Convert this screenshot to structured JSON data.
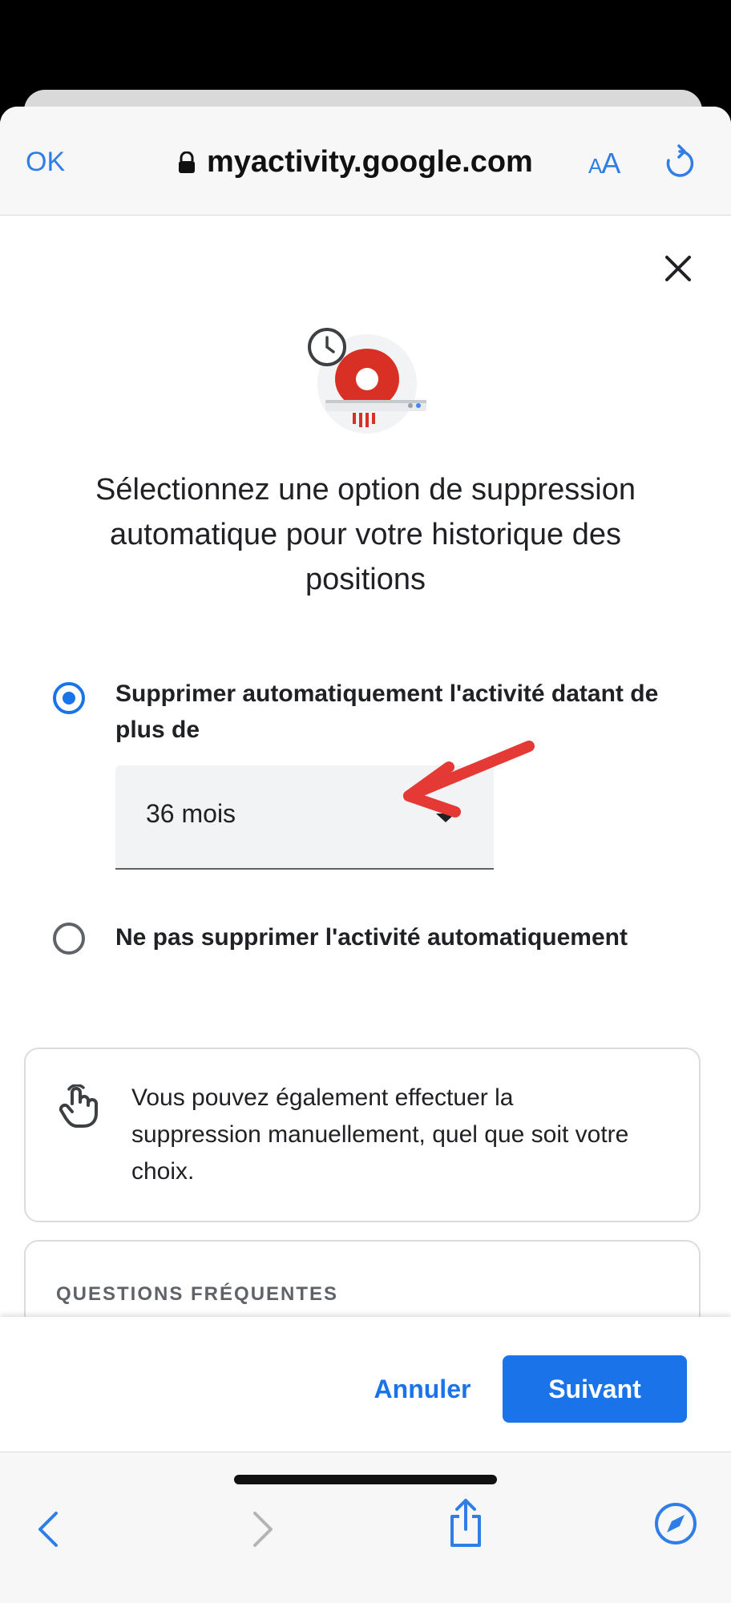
{
  "browser": {
    "done_label": "OK",
    "url": "myactivity.google.com",
    "text_size_label_small": "A",
    "text_size_label_large": "A"
  },
  "dialog": {
    "title": "Sélectionnez une option de suppression automatique pour votre historique des positions",
    "option_auto_label": "Supprimer automatiquement l'activité datant de plus de",
    "period_select_value": "36 mois",
    "option_manual_label": "Ne pas supprimer l'activité automatiquement",
    "info_text": "Vous pouvez également effectuer la suppression manuellement, quel que soit votre choix.",
    "faq_title": "QUESTIONS FRÉQUENTES",
    "cancel_label": "Annuler",
    "next_label": "Suivant"
  },
  "colors": {
    "accent": "#1a73e8",
    "safari_blue": "#2f7ee6",
    "annotation_red": "#e53935"
  }
}
